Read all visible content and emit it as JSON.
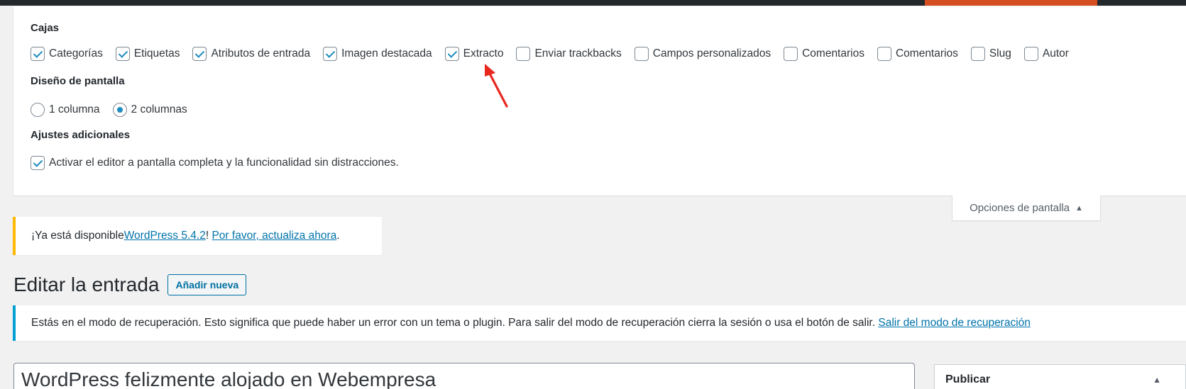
{
  "screen_options": {
    "boxes_heading": "Cajas",
    "boxes": [
      {
        "label": "Categorías",
        "checked": true
      },
      {
        "label": "Etiquetas",
        "checked": true
      },
      {
        "label": "Atributos de entrada",
        "checked": true
      },
      {
        "label": "Imagen destacada",
        "checked": true
      },
      {
        "label": "Extracto",
        "checked": true
      },
      {
        "label": "Enviar trackbacks",
        "checked": false
      },
      {
        "label": "Campos personalizados",
        "checked": false
      },
      {
        "label": "Comentarios",
        "checked": false
      },
      {
        "label": "Comentarios",
        "checked": false
      },
      {
        "label": "Slug",
        "checked": false
      },
      {
        "label": "Autor",
        "checked": false
      }
    ],
    "layout_heading": "Diseño de pantalla",
    "layout_options": [
      {
        "label": "1 columna",
        "checked": false
      },
      {
        "label": "2 columnas",
        "checked": true
      }
    ],
    "additional_heading": "Ajustes adicionales",
    "additional_option": {
      "label": "Activar el editor a pantalla completa y la funcionalidad sin distracciones.",
      "checked": true
    },
    "tab_label": "Opciones de pantalla"
  },
  "update_notice": {
    "prefix": "¡Ya está disponible ",
    "version_link": "WordPress 5.4.2",
    "middle": "! ",
    "update_link": "Por favor, actualiza ahora",
    "suffix": "."
  },
  "page": {
    "title": "Editar la entrada",
    "add_new_label": "Añadir nueva"
  },
  "recovery_notice": {
    "text": "Estás en el modo de recuperación. Esto significa que puede haber un error con un tema o plugin. Para salir del modo de recuperación cierra la sesión o usa el botón de salir. ",
    "exit_link": "Salir del modo de recuperación"
  },
  "post": {
    "title_value": "WordPress felizmente alojado en Webempresa"
  },
  "publish_box": {
    "title": "Publicar"
  },
  "colors": {
    "accent_link": "#0073aa",
    "checkbox_blue": "#1e8cbe",
    "admin_bar": "#23282d",
    "admin_bar_accent": "#d54e21",
    "update_border": "#ffb900",
    "recovery_border": "#00a0d2",
    "annotation_arrow": "#e8271f"
  }
}
